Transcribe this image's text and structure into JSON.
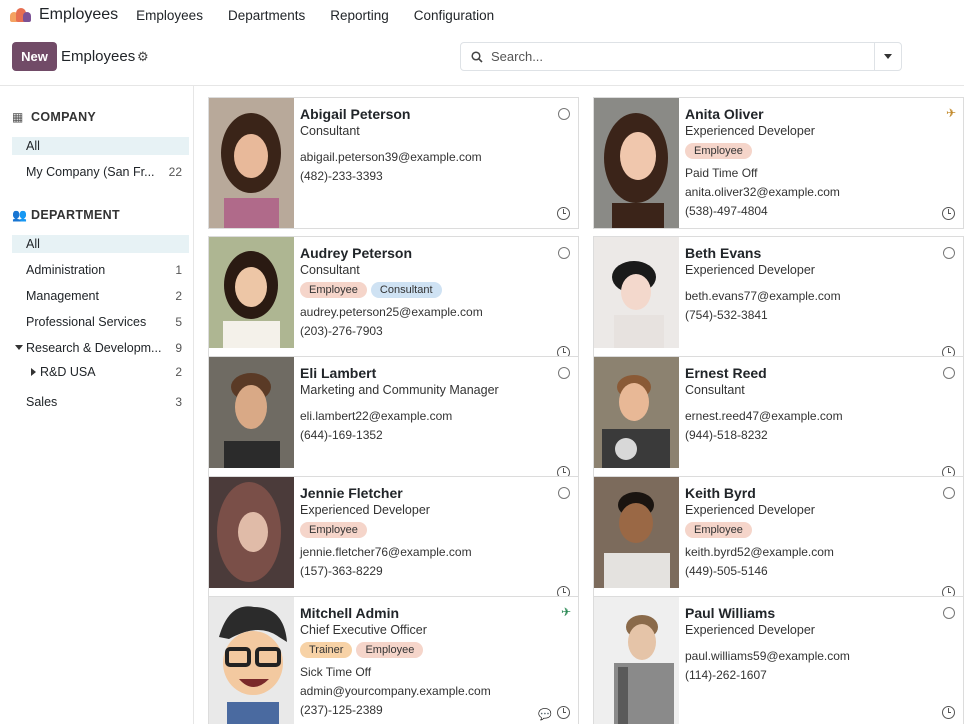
{
  "app": {
    "name": "Employees"
  },
  "menu": [
    "Employees",
    "Departments",
    "Reporting",
    "Configuration"
  ],
  "control": {
    "new_label": "New",
    "breadcrumb": "Employees",
    "search_placeholder": "Search..."
  },
  "sidebar": {
    "company_header": "COMPANY",
    "company_items": [
      {
        "label": "All",
        "count": ""
      },
      {
        "label": "My Company (San Fr...",
        "count": "22"
      }
    ],
    "department_header": "DEPARTMENT",
    "department_items": [
      {
        "label": "All",
        "count": ""
      },
      {
        "label": "Administration",
        "count": "1"
      },
      {
        "label": "Management",
        "count": "2"
      },
      {
        "label": "Professional Services",
        "count": "5"
      },
      {
        "label": "Research & Developm...",
        "count": "9"
      },
      {
        "label": "R&D USA",
        "count": "2"
      },
      {
        "label": "Sales",
        "count": "3"
      }
    ]
  },
  "employees": [
    {
      "name": "Abigail Peterson",
      "job": "Consultant",
      "tags": [],
      "extra": "",
      "email": "abigail.peterson39@example.com",
      "phone": "(482)-233-3393",
      "status": "offline"
    },
    {
      "name": "Anita Oliver",
      "job": "Experienced Developer",
      "tags": [
        "Employee"
      ],
      "extra": "Paid Time Off",
      "email": "anita.oliver32@example.com",
      "phone": "(538)-497-4804",
      "status": "away-plane"
    },
    {
      "name": "Audrey Peterson",
      "job": "Consultant",
      "tags": [
        "Employee",
        "Consultant"
      ],
      "extra": "",
      "email": "audrey.peterson25@example.com",
      "phone": "(203)-276-7903",
      "status": "offline"
    },
    {
      "name": "Beth Evans",
      "job": "Experienced Developer",
      "tags": [],
      "extra": "",
      "email": "beth.evans77@example.com",
      "phone": "(754)-532-3841",
      "status": "offline"
    },
    {
      "name": "Eli Lambert",
      "job": "Marketing and Community Manager",
      "tags": [],
      "extra": "",
      "email": "eli.lambert22@example.com",
      "phone": "(644)-169-1352",
      "status": "offline"
    },
    {
      "name": "Ernest Reed",
      "job": "Consultant",
      "tags": [],
      "extra": "",
      "email": "ernest.reed47@example.com",
      "phone": "(944)-518-8232",
      "status": "offline"
    },
    {
      "name": "Jennie Fletcher",
      "job": "Experienced Developer",
      "tags": [
        "Employee"
      ],
      "extra": "",
      "email": "jennie.fletcher76@example.com",
      "phone": "(157)-363-8229",
      "status": "offline"
    },
    {
      "name": "Keith Byrd",
      "job": "Experienced Developer",
      "tags": [
        "Employee"
      ],
      "extra": "",
      "email": "keith.byrd52@example.com",
      "phone": "(449)-505-5146",
      "status": "offline"
    },
    {
      "name": "Mitchell Admin",
      "job": "Chief Executive Officer",
      "tags": [
        "Trainer",
        "Employee"
      ],
      "extra": "Sick Time Off",
      "email": "admin@yourcompany.example.com",
      "phone": "(237)-125-2389",
      "status": "online-plane"
    },
    {
      "name": "Paul Williams",
      "job": "Experienced Developer",
      "tags": [],
      "extra": "",
      "email": "paul.williams59@example.com",
      "phone": "(114)-262-1607",
      "status": "offline"
    }
  ],
  "colors": {
    "primary": "#714b67",
    "tag_employee": "#f5d5ca",
    "tag_consultant": "#cfe2f3",
    "tag_trainer": "#f7d2a6",
    "active_filter": "#e7f2f5"
  },
  "icons": {
    "status_offline": "circle-icon",
    "time_off": "plane-icon",
    "activity": "clock-icon",
    "chat": "chat-icon"
  }
}
